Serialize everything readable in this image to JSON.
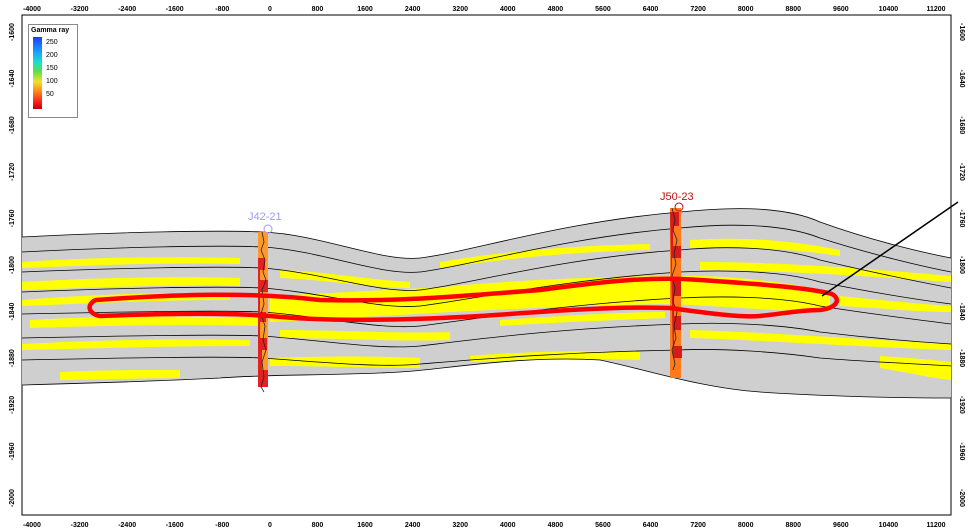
{
  "axis": {
    "x_ticks": [
      "-4000",
      "-3200",
      "-2400",
      "-1600",
      "-800",
      "0",
      "800",
      "1600",
      "2400",
      "3200",
      "4000",
      "4800",
      "5600",
      "6400",
      "7200",
      "8000",
      "8800",
      "9600",
      "10400",
      "11200"
    ],
    "y_ticks": [
      "-1600",
      "-1640",
      "-1680",
      "-1720",
      "-1760",
      "-1800",
      "-1840",
      "-1880",
      "-1920",
      "-1960",
      "-2000"
    ]
  },
  "legend": {
    "title": "Gamma ray",
    "labels": [
      "250",
      "200",
      "150",
      "100",
      "50"
    ],
    "colors": [
      "#1f3cff",
      "#19a7ff",
      "#19e0c8",
      "#5be04a",
      "#f2e12a",
      "#ff8a14",
      "#ff2020"
    ]
  },
  "wells": [
    {
      "name": "J42-21",
      "color": "#9a9aff"
    },
    {
      "name": "J50-23",
      "color": "#c01010"
    }
  ],
  "colors": {
    "formation": "#cfcfcf",
    "sand": "#ffff00",
    "highlight": "#ff0000",
    "horizon": "#000000"
  }
}
